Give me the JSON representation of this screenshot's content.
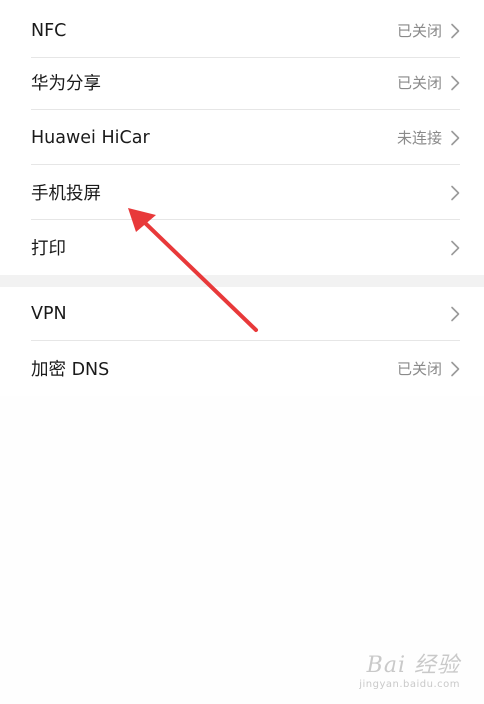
{
  "group1": {
    "items": [
      {
        "label": "NFC",
        "status": "已关闭"
      },
      {
        "label": "华为分享",
        "status": "已关闭"
      },
      {
        "label": "Huawei HiCar",
        "status": "未连接"
      },
      {
        "label": "手机投屏",
        "status": ""
      },
      {
        "label": "打印",
        "status": ""
      }
    ]
  },
  "group2": {
    "items": [
      {
        "label": "VPN",
        "status": ""
      },
      {
        "label": "加密 DNS",
        "status": "已关闭"
      }
    ]
  },
  "colors": {
    "annotation_arrow": "#e8393a",
    "chevron": "#9a9a9a"
  },
  "watermark": {
    "main": "Bai 经验",
    "sub": "jingyan.baidu.com"
  }
}
